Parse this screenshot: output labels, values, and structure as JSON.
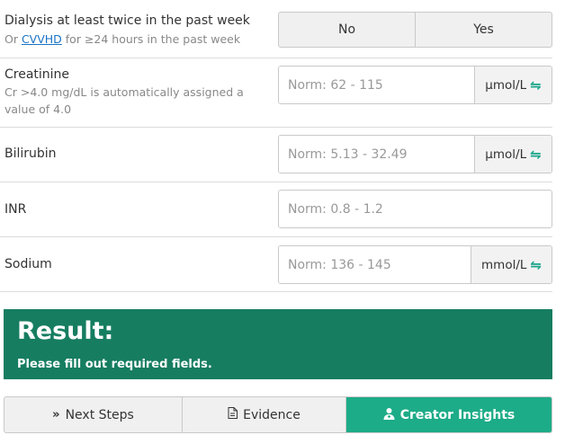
{
  "dialysis": {
    "label": "Dialysis at least twice in the past week",
    "help_prefix": "Or ",
    "help_link": "CVVHD",
    "help_suffix": " for ≥24 hours in the past week",
    "options": [
      "No",
      "Yes"
    ]
  },
  "creatinine": {
    "label": "Creatinine",
    "help": "Cr >4.0 mg/dL is automatically assigned a value of 4.0",
    "placeholder": "Norm: 62 - 115",
    "unit": "μmol/L",
    "unit_icon": "swap-units-icon"
  },
  "bilirubin": {
    "label": "Bilirubin",
    "placeholder": "Norm: 5.13 - 32.49",
    "unit": "μmol/L",
    "unit_icon": "swap-units-icon"
  },
  "inr": {
    "label": "INR",
    "placeholder": "Norm: 0.8 - 1.2"
  },
  "sodium": {
    "label": "Sodium",
    "placeholder": "Norm: 136 - 145",
    "unit": "mmol/L",
    "unit_icon": "swap-units-icon"
  },
  "result": {
    "title": "Result:",
    "message": "Please fill out required fields.",
    "background_color": "#167d61"
  },
  "tabs": {
    "next_steps": {
      "label": "Next Steps",
      "icon": "double-chevron-right-icon"
    },
    "evidence": {
      "label": "Evidence",
      "icon": "document-icon"
    },
    "creator_insights": {
      "label": "Creator Insights",
      "icon": "user-md-icon",
      "active": true,
      "color": "#1dac88"
    }
  }
}
